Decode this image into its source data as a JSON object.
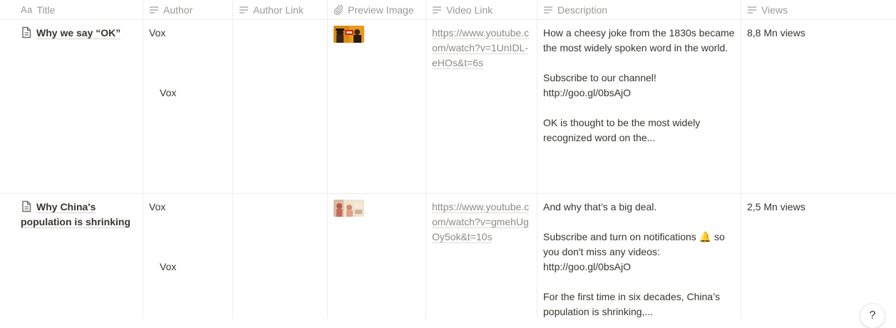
{
  "columns": {
    "title": "Title",
    "title_icon": "Aa",
    "author": "Author",
    "author_link": "Author Link",
    "preview_image": "Preview Image",
    "video_link": "Video Link",
    "description": "Description",
    "views": "Views"
  },
  "icons": {
    "text_property": "lines-icon",
    "file_property": "paperclip-icon",
    "page": "document-icon",
    "help": "question-icon"
  },
  "rows": [
    {
      "title": "Why we say “OK”",
      "author": "Vox",
      "author_sub": "Vox",
      "video_link": "https://www.youtube.com/watch?v=1UnIDL-eHOs&t=6s",
      "description": [
        "How a cheesy joke from the 1830s became the most widely spoken word in the world.",
        "Subscribe to our channel! http://goo.gl/0bsAjO",
        "OK is thought to be the most widely recognized word on the..."
      ],
      "views": "8,8 Mn views"
    },
    {
      "title": "Why China's population is shrinking",
      "author": "Vox",
      "author_sub": "Vox",
      "video_link": "https://www.youtube.com/watch?v=gmehUgOy5ok&t=10s",
      "description": [
        "And why that’s a big deal.",
        "Subscribe and turn on notifications 🔔 so you don't miss any videos: http://goo.gl/0bsAjO",
        "For the first time in six decades, China’s population is shrinking,..."
      ],
      "views": "2,5 Mn views"
    }
  ],
  "help_button": "?",
  "colors": {
    "header_text": "#9b9a97",
    "text": "#37352f",
    "border": "#ededec",
    "link": "#8d8b87"
  }
}
